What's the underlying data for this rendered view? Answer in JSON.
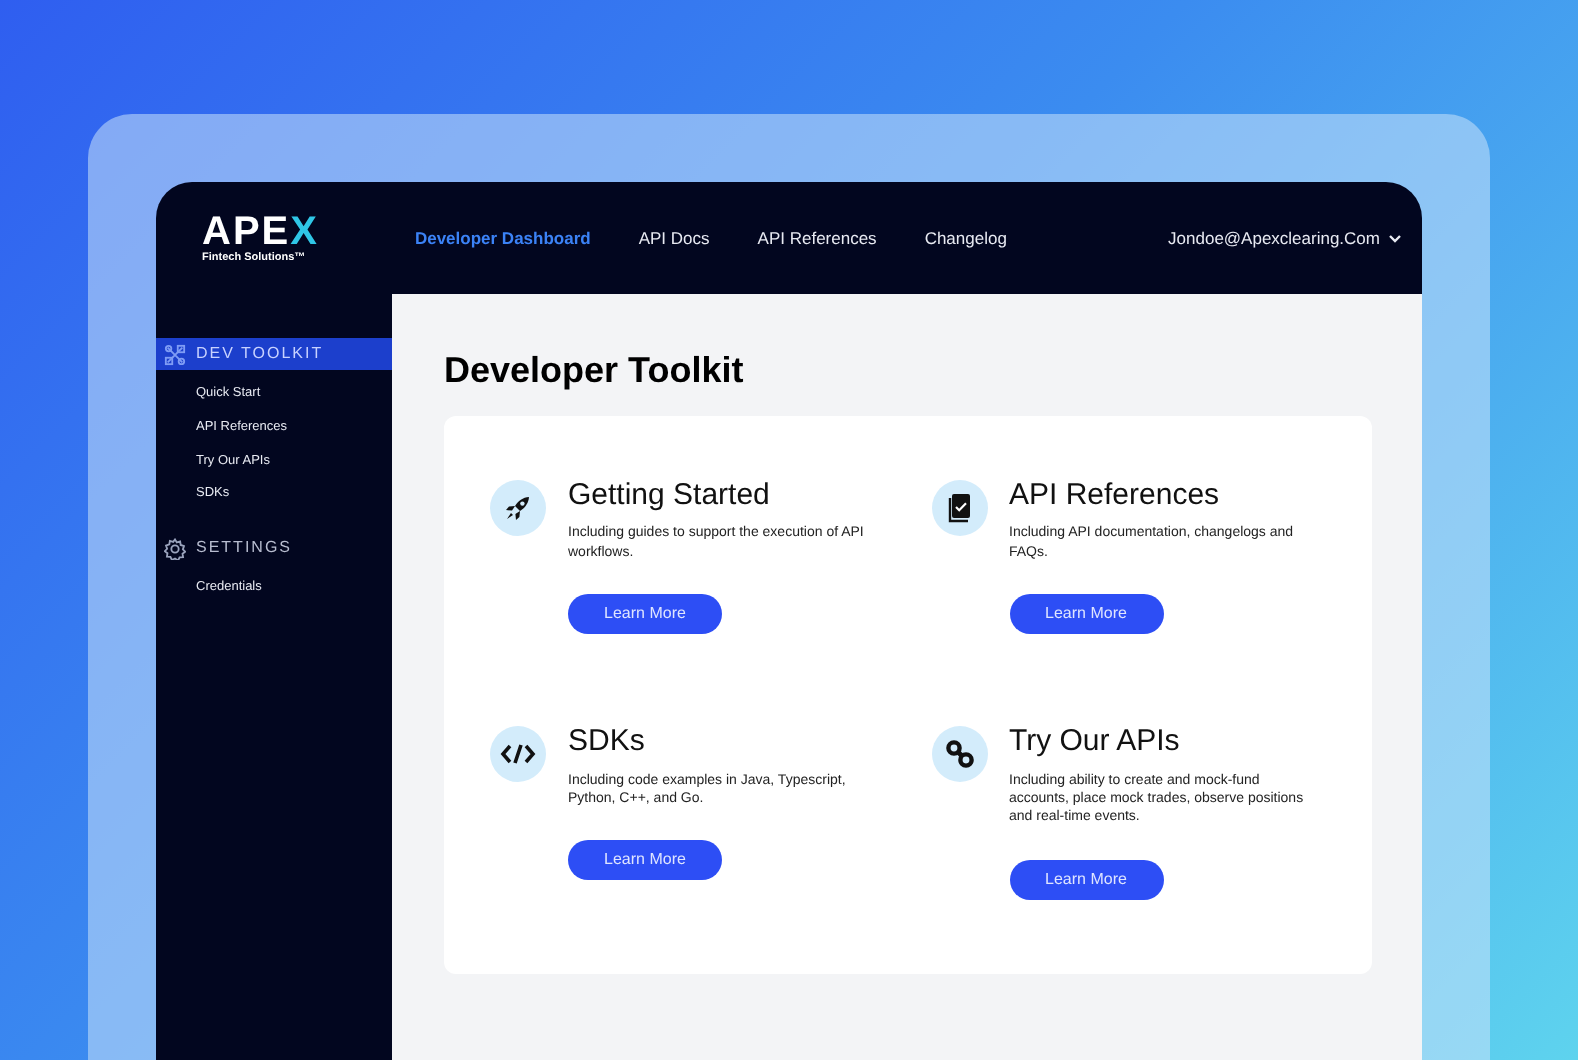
{
  "logo": {
    "text": "APE",
    "accent": "X",
    "tagline": "Fintech Solutions™"
  },
  "nav": [
    {
      "label": "Developer Dashboard",
      "selected": true
    },
    {
      "label": "API Docs",
      "selected": false
    },
    {
      "label": "API References",
      "selected": false
    },
    {
      "label": "Changelog",
      "selected": false
    }
  ],
  "user": {
    "email": "Jondoe@Apexclearing.Com"
  },
  "sidebar": {
    "sections": [
      {
        "title": "DEV TOOLKIT",
        "selected": true,
        "items": [
          "Quick Start",
          "API References",
          "Try Our APIs",
          "SDKs"
        ]
      },
      {
        "title": "SETTINGS",
        "selected": false,
        "items": [
          "Credentials"
        ]
      }
    ]
  },
  "page_title": "Developer Toolkit",
  "features": [
    {
      "title": "Getting Started",
      "description": "Including guides to support the execution of API workflows.",
      "button": "Learn More"
    },
    {
      "title": "API References",
      "description": "Including API documentation, changelogs and FAQs.",
      "button": "Learn More"
    },
    {
      "title": "SDKs",
      "description": "Including code examples in Java, Typescript, Python, C++, and Go.",
      "button": "Learn More"
    },
    {
      "title": "Try Our APIs",
      "description": "Including ability to create and mock-fund accounts, place mock trades, observe positions and real-time events.",
      "button": "Learn More"
    }
  ]
}
